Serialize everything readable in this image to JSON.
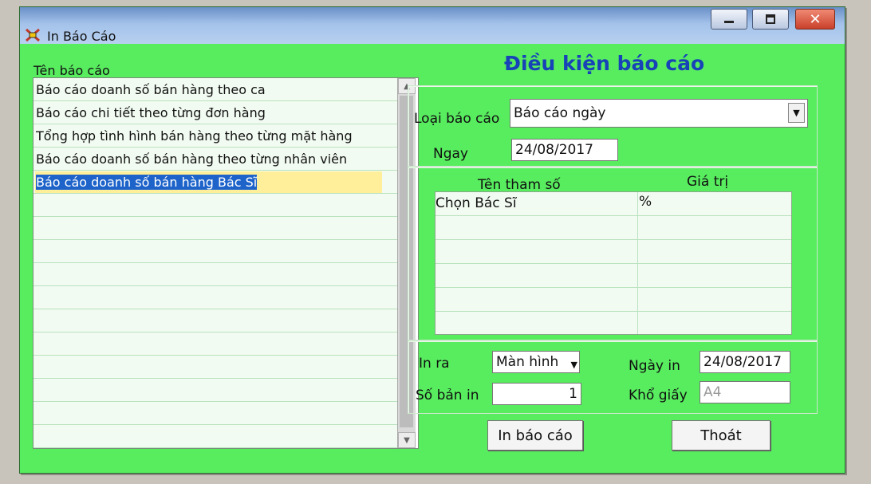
{
  "window": {
    "title": "In Báo Cáo",
    "icon": "report-app-icon",
    "controls": [
      "minimize-icon",
      "maximize-icon",
      "close-icon"
    ]
  },
  "report_list": {
    "header": "Tên báo cáo",
    "items": [
      "Báo cáo doanh số bán hàng theo ca",
      "Báo cáo chi tiết theo từng đơn hàng",
      "Tổng hợp tình hình bán hàng theo từng mặt hàng",
      "Báo cáo doanh số bán hàng theo từng nhân viên",
      "Báo cáo doanh số bán hàng Bác Sĩ"
    ],
    "selected_index": 4
  },
  "conditions": {
    "title": "Điều kiện báo cáo",
    "report_type_label": "Loại báo cáo",
    "report_type_value": "Báo cáo ngày",
    "date_label": "Ngay",
    "date_value": "24/08/2017"
  },
  "params": {
    "col_name": "Tên tham số",
    "col_value": "Giá trị",
    "rows": [
      {
        "name": "Chọn Bác Sĩ",
        "value": "%"
      }
    ]
  },
  "output": {
    "print_to_label": "In ra",
    "print_to_value": "Màn hình",
    "print_date_label": "Ngày in",
    "print_date_value": "24/08/2017",
    "copies_label": "Số bản in",
    "copies_value": "1",
    "paper_label": "Khổ giấy",
    "paper_value": "A4"
  },
  "buttons": {
    "print": "In báo cáo",
    "exit": "Thoát"
  },
  "colors": {
    "window_bg": "#58ec5f",
    "title_accent": "#1742b8",
    "selection": "#1d63c9",
    "selected_row": "#ffef9a"
  }
}
